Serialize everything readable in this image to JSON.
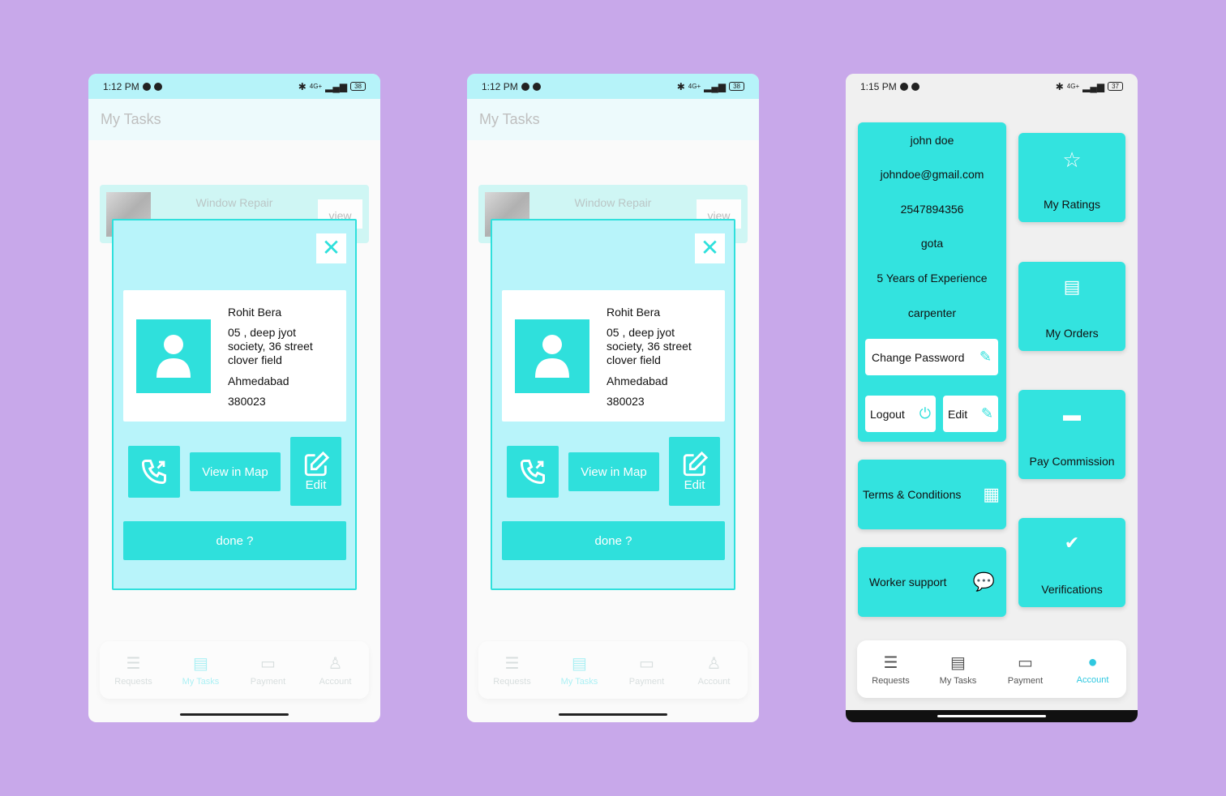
{
  "colors": {
    "accent": "#2fe0dc",
    "background": "#c8a8ea",
    "dialog": "#b8f4fa"
  },
  "tasks_screen": {
    "status": {
      "time": "1:12 PM",
      "battery": "38",
      "network": "4G+"
    },
    "title": "My Tasks",
    "task": {
      "title": "Window Repair",
      "view_label": "view"
    },
    "dialog": {
      "close_icon": "close-icon",
      "customer": {
        "name": "Rohit Bera",
        "address": "05 , deep jyot society, 36 street clover field",
        "city": "Ahmedabad",
        "pincode": "380023"
      },
      "call_icon": "phone-call-icon",
      "view_map_label": "View in Map",
      "edit_label": "Edit",
      "done_label": "done ?"
    },
    "nav": [
      {
        "label": "Requests",
        "icon": "list-icon"
      },
      {
        "label": "My Tasks",
        "icon": "clipboard-icon",
        "active": true
      },
      {
        "label": "Payment",
        "icon": "wallet-icon"
      },
      {
        "label": "Account",
        "icon": "person-icon"
      }
    ]
  },
  "account_screen": {
    "status": {
      "time": "1:15 PM",
      "battery": "37",
      "network": "4G+"
    },
    "profile": {
      "name": "john doe",
      "email": "johndoe@gmail.com",
      "phone": "2547894356",
      "location": "gota",
      "experience": "5 Years of Experience",
      "profession": "carpenter"
    },
    "change_password_label": "Change Password",
    "logout_label": "Logout",
    "edit_label": "Edit",
    "terms_label": "Terms & Conditions",
    "support_label": "Worker support",
    "tiles": [
      {
        "label": "My Ratings",
        "icon": "star-icon"
      },
      {
        "label": "My Orders",
        "icon": "orders-icon"
      },
      {
        "label": "Pay Commission",
        "icon": "card-icon"
      },
      {
        "label": "Verifications",
        "icon": "verified-icon"
      }
    ],
    "nav": [
      {
        "label": "Requests",
        "icon": "list-icon"
      },
      {
        "label": "My Tasks",
        "icon": "clipboard-icon"
      },
      {
        "label": "Payment",
        "icon": "wallet-icon"
      },
      {
        "label": "Account",
        "icon": "person-icon",
        "active": true
      }
    ]
  }
}
